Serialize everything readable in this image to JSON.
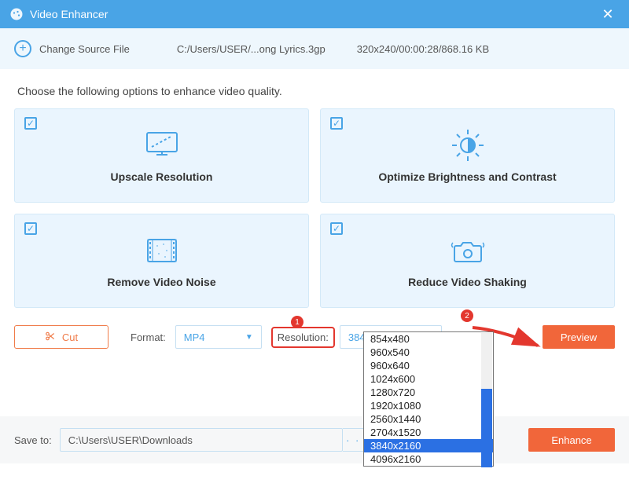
{
  "titlebar": {
    "title": "Video Enhancer"
  },
  "subbar": {
    "change_label": "Change Source File",
    "path": "C:/Users/USER/...ong Lyrics.3gp",
    "info": "320x240/00:00:28/868.16 KB"
  },
  "instruction": "Choose the following options to enhance video quality.",
  "cards": {
    "upscale": "Upscale Resolution",
    "brightness": "Optimize Brightness and Contrast",
    "noise": "Remove Video Noise",
    "shaking": "Reduce Video Shaking"
  },
  "controls": {
    "cut": "Cut",
    "format_label": "Format:",
    "format_value": "MP4",
    "res_label": "Resolution:",
    "res_value": "3840x2160",
    "preview": "Preview"
  },
  "dropdown": {
    "options": [
      "854x480",
      "960x540",
      "960x640",
      "1024x600",
      "1280x720",
      "1920x1080",
      "2560x1440",
      "2704x1520",
      "3840x2160",
      "4096x2160"
    ],
    "selected": "3840x2160"
  },
  "badges": {
    "one": "1",
    "two": "2"
  },
  "save": {
    "label": "Save to:",
    "path": "C:\\Users\\USER\\Downloads",
    "dots": "· · ·",
    "enhance": "Enhance"
  }
}
